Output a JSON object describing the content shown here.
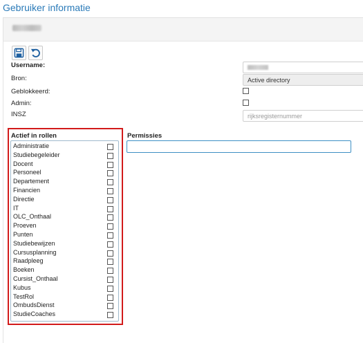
{
  "page": {
    "title": "Gebruiker informatie"
  },
  "toolbar": {
    "save_icon": "save-icon",
    "undo_icon": "undo-icon"
  },
  "form": {
    "username_label": "Username:",
    "bron_label": "Bron:",
    "bron_value": "Active directory",
    "geblokkeerd_label": "Geblokkeerd:",
    "admin_label": "Admin:",
    "insz_label": "INSZ",
    "insz_placeholder": "rijksregisternummer"
  },
  "roles": {
    "title": "Actief in rollen",
    "items": [
      {
        "label": "Administratie",
        "checked": false
      },
      {
        "label": "Studiebegeleider",
        "checked": false
      },
      {
        "label": "Docent",
        "checked": false
      },
      {
        "label": "Personeel",
        "checked": false
      },
      {
        "label": "Departement",
        "checked": false
      },
      {
        "label": "Financien",
        "checked": false
      },
      {
        "label": "Directie",
        "checked": false
      },
      {
        "label": "IT",
        "checked": false
      },
      {
        "label": "OLC_Onthaal",
        "checked": false
      },
      {
        "label": "Proeven",
        "checked": false
      },
      {
        "label": "Punten",
        "checked": false
      },
      {
        "label": "Studiebewijzen",
        "checked": false
      },
      {
        "label": "Cursusplanning",
        "checked": false
      },
      {
        "label": "Raadpleeg",
        "checked": false
      },
      {
        "label": "Boeken",
        "checked": false
      },
      {
        "label": "Cursist_Onthaal",
        "checked": false
      },
      {
        "label": "Kubus",
        "checked": false
      },
      {
        "label": "TestRol",
        "checked": false
      },
      {
        "label": "OmbudsDienst",
        "checked": false
      },
      {
        "label": "StudieCoaches",
        "checked": false
      }
    ]
  },
  "permissions": {
    "title": "Permissies"
  },
  "colors": {
    "title_blue": "#2a7ab8",
    "highlight_red": "#d21a1a",
    "focus_blue": "#3d8fc4"
  }
}
